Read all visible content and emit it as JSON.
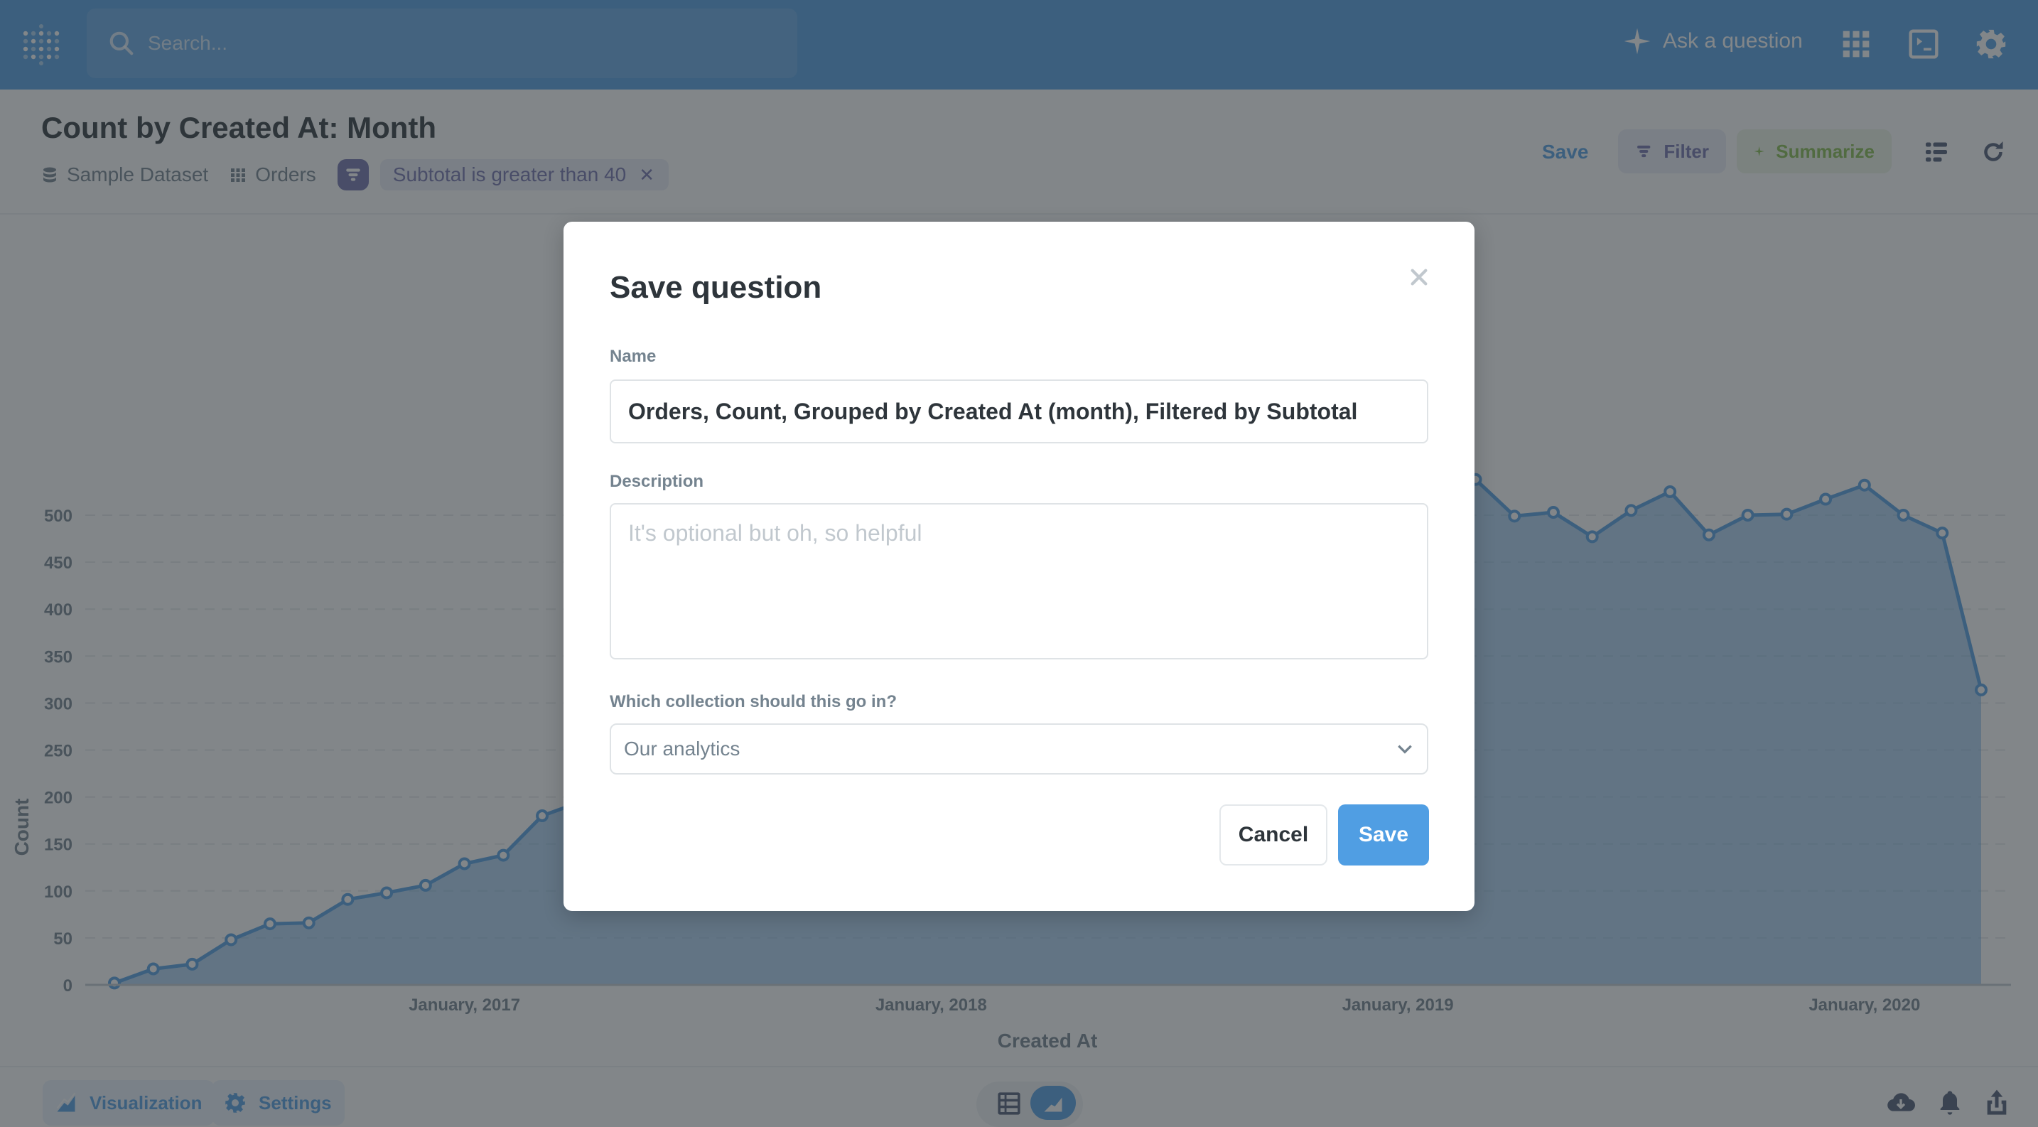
{
  "topnav": {
    "search_placeholder": "Search...",
    "ask_label": "Ask a question",
    "icons": [
      "metabase-logo-icon",
      "search-icon",
      "sparkle-icon",
      "grid-apps-icon",
      "terminal-icon",
      "gear-icon"
    ]
  },
  "header": {
    "title": "Count by Created At: Month",
    "breadcrumbs": [
      {
        "label": "Sample Dataset",
        "icon": "database-icon"
      },
      {
        "label": "Orders",
        "icon": "table-grid-icon"
      }
    ],
    "filter": {
      "label": "Subtotal is greater than 40",
      "remove": "✕"
    },
    "save_label": "Save",
    "filter_label": "Filter",
    "summarize_label": "Summarize"
  },
  "bottombar": {
    "visualization_label": "Visualization",
    "settings_label": "Settings"
  },
  "modal": {
    "title": "Save question",
    "close": "✕",
    "name_label": "Name",
    "name_value": "Orders, Count, Grouped by Created At (month), Filtered by Subtotal",
    "description_label": "Description",
    "description_placeholder": "It's optional but oh, so helpful",
    "collection_label": "Which collection should this go in?",
    "collection_value": "Our analytics",
    "cancel_label": "Cancel",
    "save_label": "Save"
  },
  "colors": {
    "brand": "#509ee3",
    "filter": "#7172ad",
    "summarize": "#84bb4c",
    "text_dark": "#2e353b",
    "text_medium": "#74838f"
  },
  "chart_data": {
    "type": "area",
    "title": "Count by Created At: Month",
    "xlabel": "Created At",
    "ylabel": "Count",
    "ylim": [
      0,
      540
    ],
    "yticks": [
      0,
      50,
      100,
      150,
      200,
      250,
      300,
      350,
      400,
      450,
      500
    ],
    "xtick_labels": [
      "January, 2017",
      "January, 2018",
      "January, 2019",
      "January, 2020"
    ],
    "grid": true,
    "legend": "none",
    "x_start": "2016-04",
    "x": [
      "2016-04",
      "2016-05",
      "2016-06",
      "2016-07",
      "2016-08",
      "2016-09",
      "2016-10",
      "2016-11",
      "2016-12",
      "2017-01",
      "2017-02",
      "2017-03",
      "2017-04",
      "2017-05",
      "2017-06",
      "2017-07",
      "2017-08",
      "2017-09",
      "2017-10",
      "2017-11",
      "2017-12",
      "2018-01",
      "2018-02",
      "2018-03",
      "2018-04",
      "2018-05",
      "2018-06",
      "2018-07",
      "2018-08",
      "2018-09",
      "2018-10",
      "2018-11",
      "2018-12",
      "2019-01",
      "2019-02",
      "2019-03",
      "2019-04",
      "2019-05",
      "2019-06",
      "2019-07",
      "2019-08",
      "2019-09",
      "2019-10",
      "2019-11",
      "2019-12",
      "2020-01",
      "2020-02",
      "2020-03",
      "2020-04"
    ],
    "series": [
      {
        "name": "Count",
        "values": [
          2,
          17,
          22,
          48,
          65,
          66,
          91,
          98,
          106,
          129,
          138,
          180,
          null,
          null,
          null,
          null,
          null,
          null,
          null,
          null,
          null,
          null,
          null,
          null,
          null,
          null,
          null,
          null,
          null,
          null,
          null,
          null,
          null,
          null,
          null,
          538,
          499,
          503,
          477,
          505,
          525,
          479,
          500,
          501,
          517,
          532,
          500,
          481,
          314
        ]
      }
    ],
    "note": "null values are months hidden behind the modal dialog"
  }
}
